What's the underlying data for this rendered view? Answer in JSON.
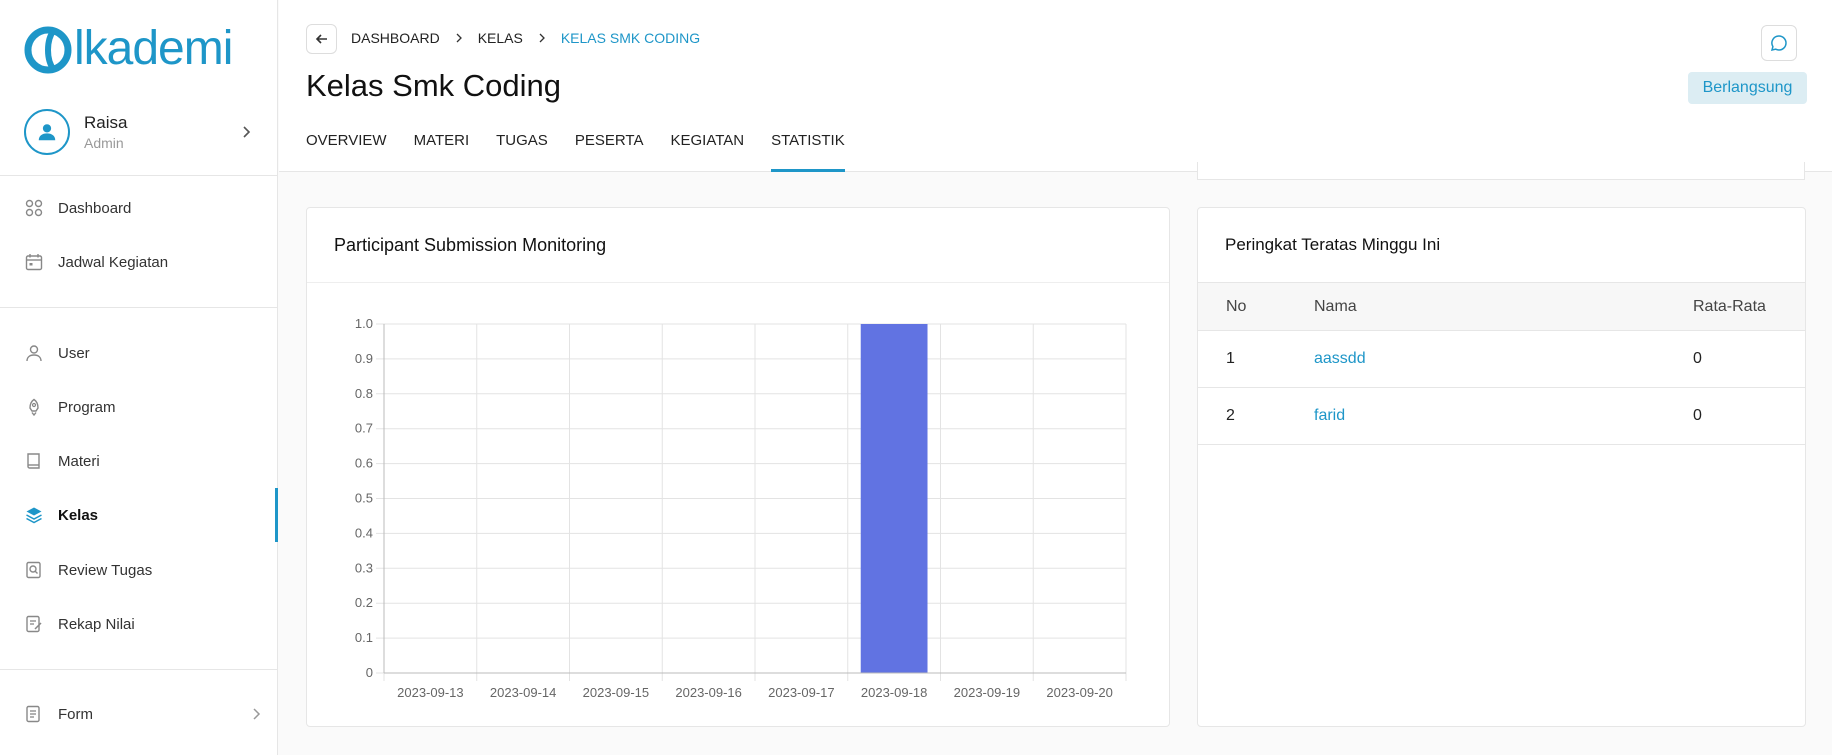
{
  "app": {
    "logo_text": "lkademi",
    "logo_color": "#1e96c8"
  },
  "user": {
    "name": "Raisa",
    "role": "Admin"
  },
  "sidebar": {
    "items": [
      {
        "label": "Dashboard",
        "icon": "grid-icon"
      },
      {
        "label": "Jadwal Kegiatan",
        "icon": "calendar-icon"
      },
      {
        "label": "User",
        "icon": "user-icon"
      },
      {
        "label": "Program",
        "icon": "rocket-icon"
      },
      {
        "label": "Materi",
        "icon": "book-icon"
      },
      {
        "label": "Kelas",
        "icon": "layers-icon",
        "active": true
      },
      {
        "label": "Review Tugas",
        "icon": "search-doc-icon"
      },
      {
        "label": "Rekap Nilai",
        "icon": "edit-doc-icon"
      },
      {
        "label": "Form",
        "icon": "form-icon"
      }
    ]
  },
  "breadcrumb": {
    "items": [
      "DASHBOARD",
      "KELAS",
      "KELAS SMK CODING"
    ]
  },
  "page": {
    "title": "Kelas Smk Coding",
    "status": "Berlangsung"
  },
  "tabs": [
    "OVERVIEW",
    "MATERI",
    "TUGAS",
    "PESERTA",
    "KEGIATAN",
    "STATISTIK"
  ],
  "active_tab": "STATISTIK",
  "chart_card": {
    "title": "Participant Submission Monitoring"
  },
  "chart_data": {
    "type": "bar",
    "categories": [
      "2023-09-13",
      "2023-09-14",
      "2023-09-15",
      "2023-09-16",
      "2023-09-17",
      "2023-09-18",
      "2023-09-19",
      "2023-09-20"
    ],
    "values": [
      0,
      0,
      0,
      0,
      0,
      1.0,
      0,
      0
    ],
    "ylim": [
      0,
      1.0
    ],
    "yticks": [
      "0",
      "0.1",
      "0.2",
      "0.3",
      "0.4",
      "0.5",
      "0.6",
      "0.7",
      "0.8",
      "0.9",
      "1.0"
    ],
    "bar_color": "#6173e2",
    "grid": true
  },
  "ranking": {
    "title": "Peringkat Teratas Minggu Ini",
    "columns": [
      "No",
      "Nama",
      "Rata-Rata"
    ],
    "rows": [
      {
        "no": "1",
        "nama": "aassdd",
        "rata": "0"
      },
      {
        "no": "2",
        "nama": "farid",
        "rata": "0"
      }
    ]
  }
}
